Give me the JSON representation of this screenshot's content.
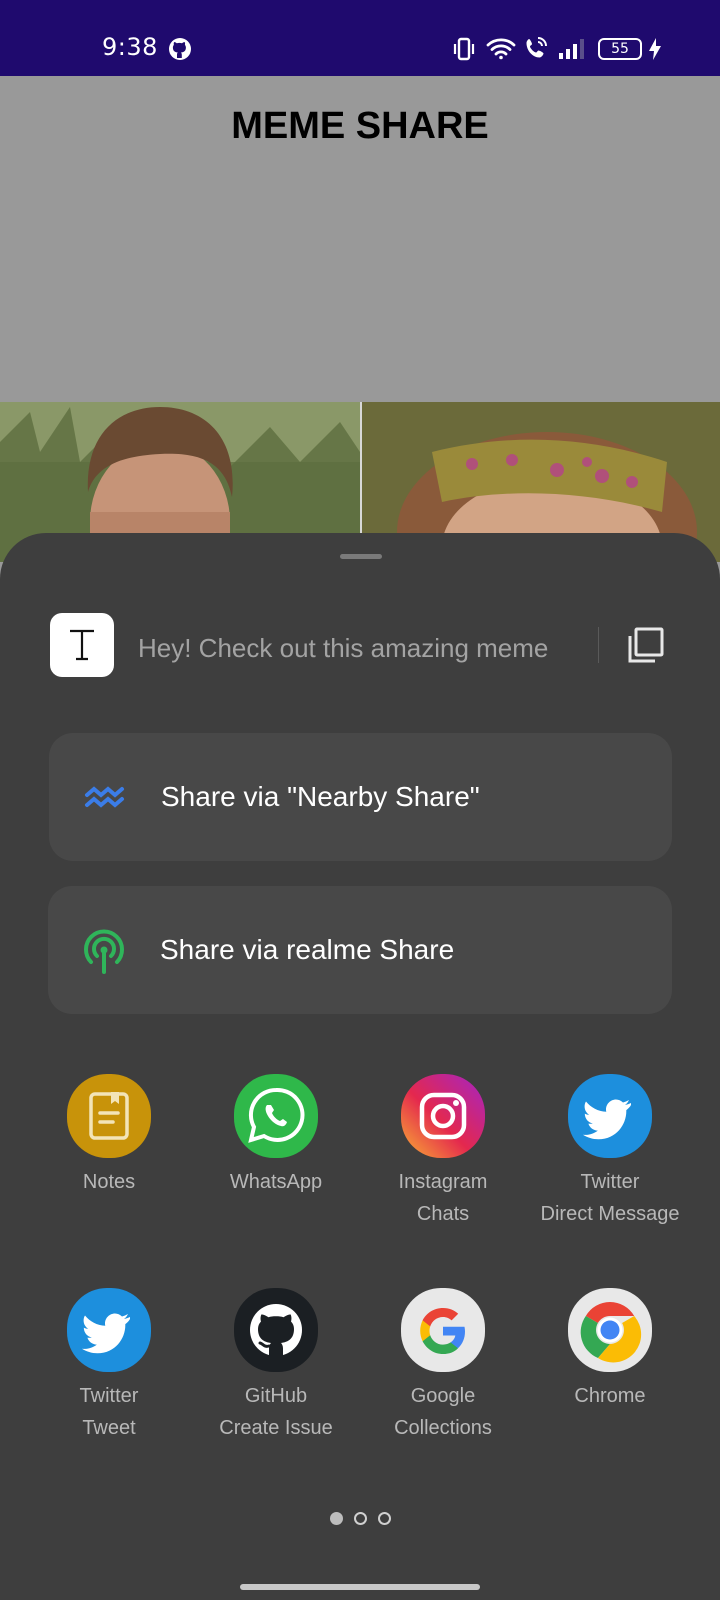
{
  "status_bar": {
    "time": "9:38",
    "battery": "55",
    "icons": [
      "github-icon",
      "vibrate-icon",
      "wifi-icon",
      "wifi-calling-icon",
      "signal-icon",
      "battery-icon",
      "charging-icon"
    ]
  },
  "app": {
    "title": "MEME SHARE"
  },
  "share_sheet": {
    "preview_text": "Hey! Check out this amazing meme",
    "options": [
      {
        "label": "Share via \"Nearby Share\"",
        "icon": "nearby-share-icon",
        "color": "#3b7de8"
      },
      {
        "label": "Share via realme Share",
        "icon": "realme-share-icon",
        "color": "#2fb55a"
      }
    ],
    "targets": [
      {
        "line1": "Notes",
        "line2": "",
        "icon": "notes-icon",
        "color": "#c8930a"
      },
      {
        "line1": "WhatsApp",
        "line2": "",
        "icon": "whatsapp-icon",
        "color": "#2fb84a"
      },
      {
        "line1": "Instagram",
        "line2": "Chats",
        "icon": "instagram-icon",
        "color": "#d62976"
      },
      {
        "line1": "Twitter",
        "line2": "Direct Message",
        "icon": "twitter-icon",
        "color": "#1d8fdd"
      },
      {
        "line1": "Twitter",
        "line2": "Tweet",
        "icon": "twitter-icon",
        "color": "#1d8fdd"
      },
      {
        "line1": "GitHub",
        "line2": "Create Issue",
        "icon": "github-icon",
        "color": "#1b1f23"
      },
      {
        "line1": "Google",
        "line2": "Collections",
        "icon": "google-icon",
        "color": "#e8e8e8"
      },
      {
        "line1": "Chrome",
        "line2": "",
        "icon": "chrome-icon",
        "color": "#e8e8e8"
      }
    ],
    "page_indicator": {
      "current": 1,
      "total": 3
    }
  }
}
